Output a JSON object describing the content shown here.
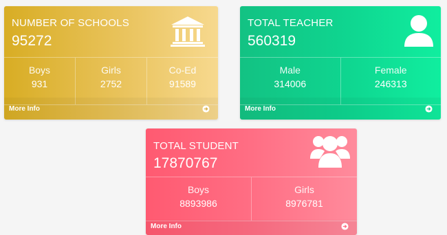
{
  "cards": {
    "schools": {
      "title": "NUMBER OF SCHOOLS",
      "total": "95272",
      "icon": "institution-icon",
      "stats": [
        {
          "label": "Boys",
          "value": "931"
        },
        {
          "label": "Girls",
          "value": "2752"
        },
        {
          "label": "Co-Ed",
          "value": "91589"
        }
      ],
      "more_info": "More Info",
      "color": "#e2b94a"
    },
    "teacher": {
      "title": "TOTAL TEACHER",
      "total": "560319",
      "icon": "user-icon",
      "stats": [
        {
          "label": "Male",
          "value": "314006"
        },
        {
          "label": "Female",
          "value": "246313"
        }
      ],
      "more_info": "More Info",
      "color": "#12d690"
    },
    "student": {
      "title": "TOTAL STUDENT",
      "total": "17870767",
      "icon": "users-group-icon",
      "stats": [
        {
          "label": "Boys",
          "value": "8893986"
        },
        {
          "label": "Girls",
          "value": "8976781"
        }
      ],
      "more_info": "More Info",
      "color": "#ff6e84"
    }
  }
}
